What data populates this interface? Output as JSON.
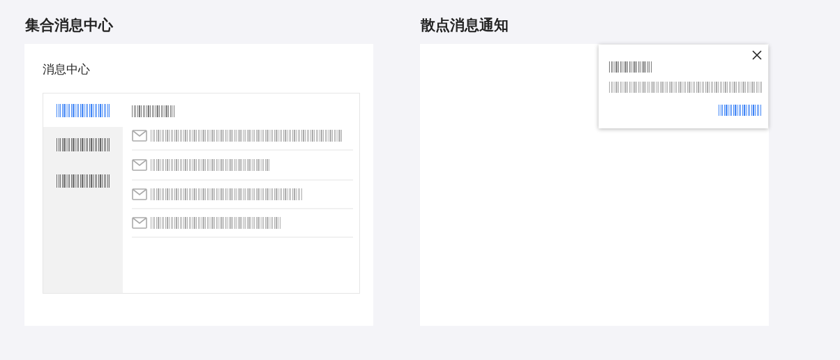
{
  "sections": [
    {
      "title": "集合消息中心"
    },
    {
      "title": "散点消息通知"
    }
  ],
  "message_center": {
    "title": "消息中心",
    "tabs": [
      {
        "selected": true
      },
      {
        "selected": false
      },
      {
        "selected": false
      }
    ],
    "messages": [
      {
        "kind": "mail"
      },
      {
        "kind": "mail"
      },
      {
        "kind": "mail"
      },
      {
        "kind": "mail"
      }
    ]
  },
  "notification": {
    "closable": true
  }
}
